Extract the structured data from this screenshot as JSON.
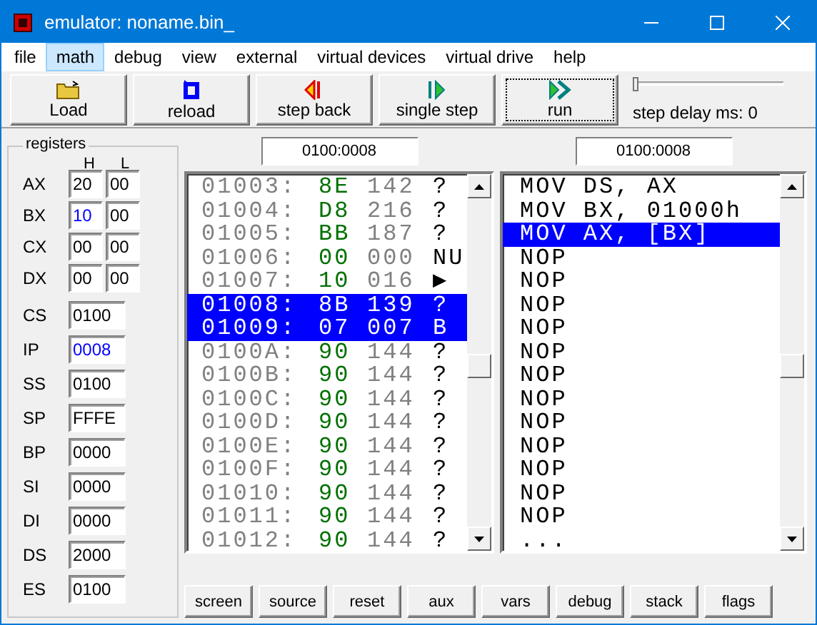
{
  "window": {
    "title": "emulator: noname.bin_"
  },
  "menu": [
    {
      "label": "file",
      "selected": false
    },
    {
      "label": "math",
      "selected": true
    },
    {
      "label": "debug",
      "selected": false
    },
    {
      "label": "view",
      "selected": false
    },
    {
      "label": "external",
      "selected": false
    },
    {
      "label": "virtual devices",
      "selected": false
    },
    {
      "label": "virtual drive",
      "selected": false
    },
    {
      "label": "help",
      "selected": false
    }
  ],
  "toolbar": [
    {
      "label": "Load",
      "kind": "load",
      "focused": false
    },
    {
      "label": "reload",
      "kind": "reload",
      "focused": false
    },
    {
      "label": "step back",
      "kind": "back",
      "focused": false
    },
    {
      "label": "single step",
      "kind": "step",
      "focused": false
    },
    {
      "label": "run",
      "kind": "run",
      "focused": true
    }
  ],
  "step_delay": {
    "label": "step delay ms: 0",
    "level": 0
  },
  "registers": {
    "title": "registers",
    "col_h": "H",
    "col_l": "L",
    "pairs": [
      {
        "name": "AX",
        "high": "20",
        "low": "00",
        "high_changed": false
      },
      {
        "name": "BX",
        "high": "10",
        "low": "00",
        "high_changed": true
      },
      {
        "name": "CX",
        "high": "00",
        "low": "00",
        "high_changed": false
      },
      {
        "name": "DX",
        "high": "00",
        "low": "00",
        "high_changed": false
      }
    ],
    "words": [
      {
        "name": "CS",
        "value": "0100",
        "changed": false
      },
      {
        "name": "IP",
        "value": "0008",
        "changed": true
      },
      {
        "name": "SS",
        "value": "0100",
        "changed": false
      },
      {
        "name": "SP",
        "value": "FFFE",
        "changed": false
      },
      {
        "name": "BP",
        "value": "0000",
        "changed": false
      },
      {
        "name": "SI",
        "value": "0000",
        "changed": false
      },
      {
        "name": "DI",
        "value": "0000",
        "changed": false
      },
      {
        "name": "DS",
        "value": "2000",
        "changed": false
      },
      {
        "name": "ES",
        "value": "0100",
        "changed": false
      }
    ]
  },
  "memory": {
    "address": "0100:0008",
    "rows": [
      {
        "addr": "01003:",
        "hex": "8E",
        "dec": "142",
        "char": "?",
        "selected": false
      },
      {
        "addr": "01004:",
        "hex": "D8",
        "dec": "216",
        "char": "?",
        "selected": false
      },
      {
        "addr": "01005:",
        "hex": "BB",
        "dec": "187",
        "char": "?",
        "selected": false
      },
      {
        "addr": "01006:",
        "hex": "00",
        "dec": "000",
        "char": "NU",
        "selected": false
      },
      {
        "addr": "01007:",
        "hex": "10",
        "dec": "016",
        "char": "▶",
        "selected": false
      },
      {
        "addr": "01008:",
        "hex": "8B",
        "dec": "139",
        "char": "?",
        "selected": true
      },
      {
        "addr": "01009:",
        "hex": "07",
        "dec": "007",
        "char": "B",
        "selected": true
      },
      {
        "addr": "0100A:",
        "hex": "90",
        "dec": "144",
        "char": "?",
        "selected": false
      },
      {
        "addr": "0100B:",
        "hex": "90",
        "dec": "144",
        "char": "?",
        "selected": false
      },
      {
        "addr": "0100C:",
        "hex": "90",
        "dec": "144",
        "char": "?",
        "selected": false
      },
      {
        "addr": "0100D:",
        "hex": "90",
        "dec": "144",
        "char": "?",
        "selected": false
      },
      {
        "addr": "0100E:",
        "hex": "90",
        "dec": "144",
        "char": "?",
        "selected": false
      },
      {
        "addr": "0100F:",
        "hex": "90",
        "dec": "144",
        "char": "?",
        "selected": false
      },
      {
        "addr": "01010:",
        "hex": "90",
        "dec": "144",
        "char": "?",
        "selected": false
      },
      {
        "addr": "01011:",
        "hex": "90",
        "dec": "144",
        "char": "?",
        "selected": false
      },
      {
        "addr": "01012:",
        "hex": "90",
        "dec": "144",
        "char": "?",
        "selected": false
      }
    ]
  },
  "disassembly": {
    "address": "0100:0008",
    "rows": [
      {
        "text": "MOV DS, AX",
        "selected": false
      },
      {
        "text": "MOV BX, 01000h",
        "selected": false
      },
      {
        "text": "MOV AX, [BX]",
        "selected": true
      },
      {
        "text": "NOP",
        "selected": false
      },
      {
        "text": "NOP",
        "selected": false
      },
      {
        "text": "NOP",
        "selected": false
      },
      {
        "text": "NOP",
        "selected": false
      },
      {
        "text": "NOP",
        "selected": false
      },
      {
        "text": "NOP",
        "selected": false
      },
      {
        "text": "NOP",
        "selected": false
      },
      {
        "text": "NOP",
        "selected": false
      },
      {
        "text": "NOP",
        "selected": false
      },
      {
        "text": "NOP",
        "selected": false
      },
      {
        "text": "NOP",
        "selected": false
      },
      {
        "text": "NOP",
        "selected": false
      },
      {
        "text": "...",
        "selected": false
      }
    ]
  },
  "bottom_buttons": [
    "screen",
    "source",
    "reset",
    "aux",
    "vars",
    "debug",
    "stack",
    "flags"
  ]
}
